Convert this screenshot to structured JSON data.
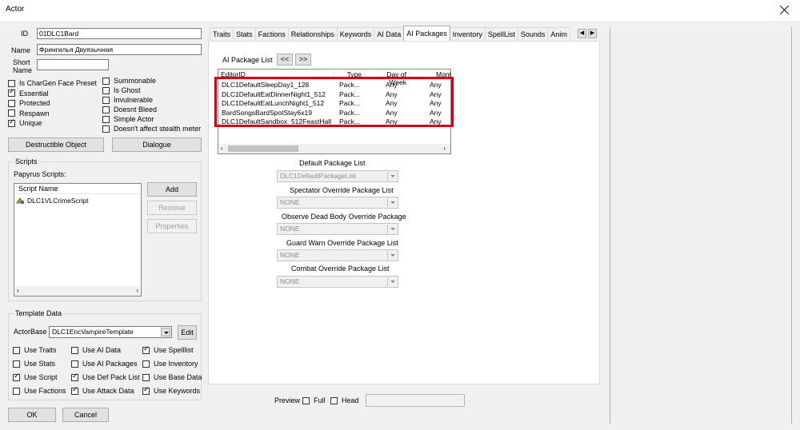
{
  "window": {
    "title": "Actor"
  },
  "id": {
    "label": "ID",
    "value": "01DLC1Bard"
  },
  "name": {
    "label": "Name",
    "value": "Фрингилья Двуязычная"
  },
  "short_name": {
    "label_line1": "Short",
    "label_line2": "Name",
    "value": ""
  },
  "flags_left": [
    {
      "label": "Is CharGen Face Preset",
      "checked": false
    },
    {
      "label": "Essential",
      "checked": true
    },
    {
      "label": "Protected",
      "checked": false
    },
    {
      "label": "Respawn",
      "checked": false
    },
    {
      "label": "Unique",
      "checked": true
    }
  ],
  "flags_right": [
    {
      "label": "Summonable",
      "checked": false
    },
    {
      "label": "Is Ghost",
      "checked": false
    },
    {
      "label": "Invulnerable",
      "checked": false
    },
    {
      "label": "Doesnt Bleed",
      "checked": false
    },
    {
      "label": "Simple Actor",
      "checked": false
    },
    {
      "label": "Doesn't affect stealth meter",
      "checked": false
    }
  ],
  "buttons": {
    "destructible": "Destructible Object",
    "dialogue": "Dialogue",
    "ok": "OK",
    "cancel": "Cancel"
  },
  "scripts": {
    "group_label": "Scripts",
    "papyrus_label": "Papyrus Scripts:",
    "column": "Script Name",
    "items": [
      "DLC1VLCrimeScript"
    ],
    "add": "Add",
    "remove": "Remove",
    "properties": "Properties"
  },
  "template": {
    "group_label": "Template Data",
    "actorbase_label": "ActorBase",
    "actorbase_value": "DLC1EncVampireTemplate",
    "edit": "Edit",
    "options": [
      {
        "label": "Use Traits",
        "checked": false
      },
      {
        "label": "Use AI Data",
        "checked": false
      },
      {
        "label": "Use Spelllist",
        "checked": true
      },
      {
        "label": "Use Stats",
        "checked": false
      },
      {
        "label": "Use AI Packages",
        "checked": false
      },
      {
        "label": "Use Inventory",
        "checked": false
      },
      {
        "label": "Use Script",
        "checked": true
      },
      {
        "label": "Use Def Pack List",
        "checked": true
      },
      {
        "label": "Use Base Data",
        "checked": false
      },
      {
        "label": "Use Factions",
        "checked": false
      },
      {
        "label": "Use Attack Data",
        "checked": true
      },
      {
        "label": "Use Keywords",
        "checked": true
      }
    ]
  },
  "tabs": [
    "Traits",
    "Stats",
    "Factions",
    "Relationships",
    "Keywords",
    "AI Data",
    "AI Packages",
    "Inventory",
    "SpellList",
    "Sounds",
    "Anim"
  ],
  "active_tab": "AI Packages",
  "ai_packages": {
    "list_label": "AI Package List",
    "prev_btn": "<<",
    "next_btn": ">>",
    "columns": [
      "EditorID",
      "Type",
      "Day of Week",
      "Month"
    ],
    "rows": [
      [
        "DLC1DefaultSleepDay1_128",
        "Pack...",
        "Any",
        "Any"
      ],
      [
        "DLC1DefaultEatDinnerNight1_512",
        "Pack...",
        "Any",
        "Any"
      ],
      [
        "DLC1DefaultEatLunchNight1_512",
        "Pack...",
        "Any",
        "Any"
      ],
      [
        "BardSongsBardSpotStay6x19",
        "Pack...",
        "Any",
        "Any"
      ],
      [
        "DLC1DefaultSandbox_512FeastHall",
        "Pack...",
        "Any",
        "Any"
      ]
    ],
    "default_list_label": "Default Package List",
    "default_list_value": "DLC1DefaultPackageList",
    "spectator_label": "Spectator Override Package List",
    "spectator_value": "NONE",
    "observe_label": "Observe Dead Body Override Package",
    "observe_value": "NONE",
    "guard_label": "Guard Warn Override Package List",
    "guard_value": "NONE",
    "combat_label": "Combat Override Package List",
    "combat_value": "NONE"
  },
  "preview": {
    "label": "Preview",
    "full": "Full",
    "head": "Head"
  },
  "colors": {
    "highlight": "#d5001a"
  }
}
